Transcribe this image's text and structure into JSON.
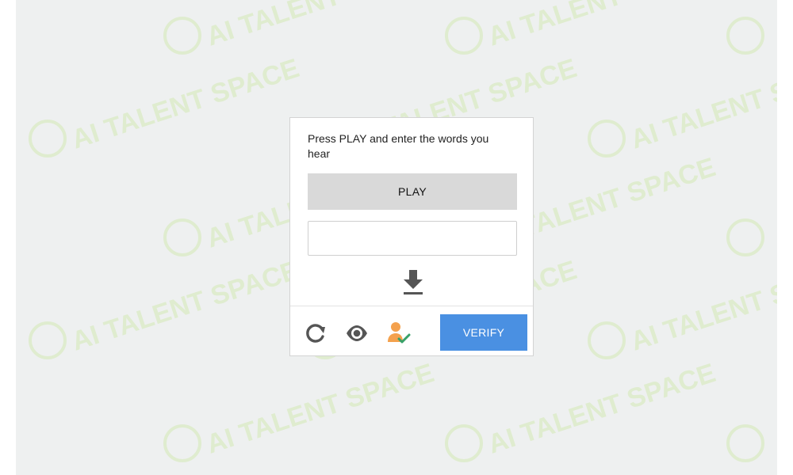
{
  "captcha": {
    "instructions": "Press PLAY and enter the words you hear",
    "play_label": "PLAY",
    "answer_value": "",
    "verify_label": "VERIFY"
  },
  "icons": {
    "download": "download-icon",
    "reload": "reload-icon",
    "eye": "eye-icon",
    "accessibility": "accessibility-user-check-icon"
  },
  "colors": {
    "background": "#eef0f0",
    "verify": "#4a90e2",
    "play": "#d9d9d9",
    "watermark": "#dfeccf",
    "accessibility_user": "#f4a14d",
    "accessibility_check": "#38a169"
  },
  "watermark": {
    "text": "AI TALENT SPACE"
  }
}
